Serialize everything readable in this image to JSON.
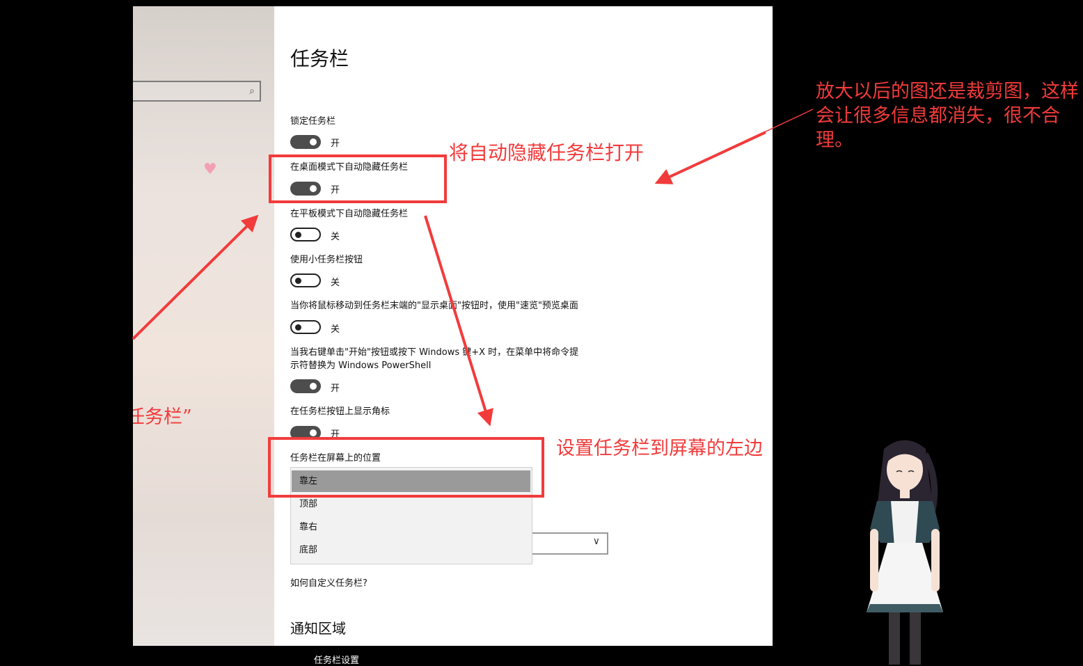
{
  "sidebar": {
    "search_icon": "search-icon",
    "heart_icon": "heart-icon"
  },
  "page": {
    "title": "任务栏",
    "settings": [
      {
        "label": "锁定任务栏",
        "state": "开",
        "on": true
      },
      {
        "label": "在桌面模式下自动隐藏任务栏",
        "state": "开",
        "on": true
      },
      {
        "label": "在平板模式下自动隐藏任务栏",
        "state": "关",
        "on": false
      },
      {
        "label": "使用小任务栏按钮",
        "state": "关",
        "on": false
      },
      {
        "label": "当你将鼠标移动到任务栏末端的\"显示桌面\"按钮时，使用\"速览\"预览桌面",
        "state": "关",
        "on": false
      },
      {
        "label_line1": "当我右键单击\"开始\"按钮或按下 Windows 键+X 时，在菜单中将命令提",
        "label_line2": "示符替换为 Windows PowerShell",
        "state": "开",
        "on": true
      },
      {
        "label": "在任务栏按钮上显示角标",
        "state": "开",
        "on": true
      }
    ],
    "position_label": "任务栏在屏幕上的位置",
    "position_options": [
      "靠左",
      "顶部",
      "靠右",
      "底部"
    ],
    "position_selected": "靠左",
    "link": "如何自定义任务栏?",
    "section_title": "通知区域"
  },
  "caption": "任务栏设置",
  "annotations": {
    "auto_hide": "将自动隐藏任务栏打开",
    "position": "设置任务栏到屏幕的左边",
    "left_partial": "任务栏”",
    "comment": "放大以后的图还是裁剪图，这样会让很多信息都消失，很不合理。"
  },
  "colors": {
    "annotation_red": "#f23b3b",
    "toggle_on": "#4d4d4d",
    "selected_item": "#9a9a9a"
  }
}
